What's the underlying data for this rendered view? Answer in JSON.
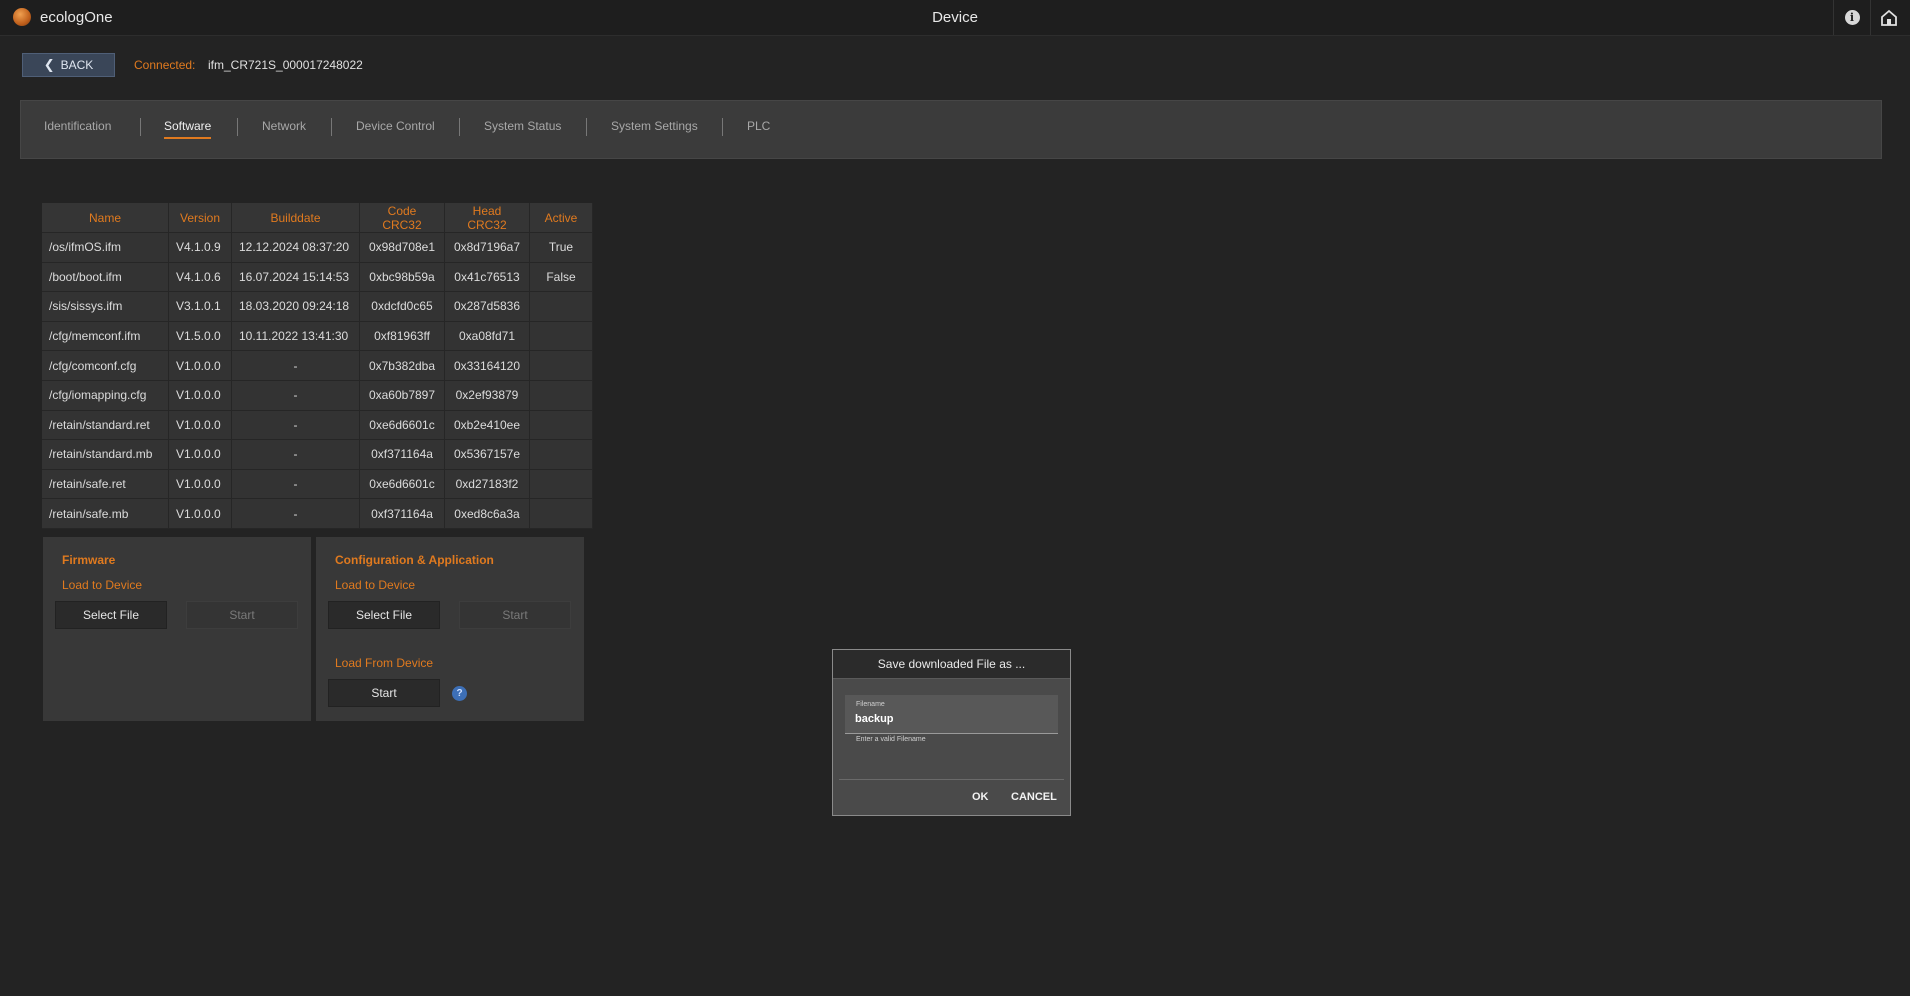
{
  "app": {
    "name": "ecologOne",
    "window_title": "Device",
    "info_icon": "info-icon",
    "home_icon": "home-icon",
    "logo_color": "#d0702a"
  },
  "connection": {
    "back_label": "BACK",
    "label": "Connected:",
    "value": "ifm_CR721S_000017248022"
  },
  "tabs": [
    {
      "label": "Identification",
      "active": false
    },
    {
      "label": "Software",
      "active": true
    },
    {
      "label": "Network",
      "active": false
    },
    {
      "label": "Device Control",
      "active": false
    },
    {
      "label": "System Status",
      "active": false
    },
    {
      "label": "System Settings",
      "active": false
    },
    {
      "label": "PLC",
      "active": false
    }
  ],
  "software_table": {
    "headers": [
      "Name",
      "Version",
      "Builddate",
      "Code CRC32",
      "Head CRC32",
      "Active"
    ],
    "rows": [
      [
        "/os/ifmOS.ifm",
        "V4.1.0.9",
        "12.12.2024 08:37:20",
        "0x98d708e1",
        "0x8d7196a7",
        "True"
      ],
      [
        "/boot/boot.ifm",
        "V4.1.0.6",
        "16.07.2024 15:14:53",
        "0xbc98b59a",
        "0x41c76513",
        "False"
      ],
      [
        "/sis/sissys.ifm",
        "V3.1.0.1",
        "18.03.2020 09:24:18",
        "0xdcfd0c65",
        "0x287d5836",
        ""
      ],
      [
        "/cfg/memconf.ifm",
        "V1.5.0.0",
        "10.11.2022 13:41:30",
        "0xf81963ff",
        "0xa08fd71",
        ""
      ],
      [
        "/cfg/comconf.cfg",
        "V1.0.0.0",
        "-",
        "0x7b382dba",
        "0x33164120",
        ""
      ],
      [
        "/cfg/iomapping.cfg",
        "V1.0.0.0",
        "-",
        "0xa60b7897",
        "0x2ef93879",
        ""
      ],
      [
        "/retain/standard.ret",
        "V1.0.0.0",
        "-",
        "0xe6d6601c",
        "0xb2e410ee",
        ""
      ],
      [
        "/retain/standard.mb",
        "V1.0.0.0",
        "-",
        "0xf371164a",
        "0x5367157e",
        ""
      ],
      [
        "/retain/safe.ret",
        "V1.0.0.0",
        "-",
        "0xe6d6601c",
        "0xd27183f2",
        ""
      ],
      [
        "/retain/safe.mb",
        "V1.0.0.0",
        "-",
        "0xf371164a",
        "0xed8c6a3a",
        ""
      ]
    ]
  },
  "firmware_panel": {
    "title": "Firmware",
    "load_to_device": "Load to Device",
    "select_file": "Select File",
    "start": "Start"
  },
  "config_panel": {
    "title": "Configuration & Application",
    "load_to_device": "Load to Device",
    "select_file": "Select File",
    "start": "Start",
    "load_from_device": "Load From Device",
    "start_download": "Start",
    "help_icon": "help-icon"
  },
  "dialog": {
    "title": "Save downloaded File as ...",
    "field_label": "Filename",
    "field_value": "backup",
    "field_hint": "Enter a valid Filename",
    "ok": "OK",
    "cancel": "CANCEL"
  },
  "colors": {
    "accent": "#e07a1f",
    "background": "#232323",
    "back_button": "#3a4658",
    "help_icon": "#3d6fb6"
  }
}
